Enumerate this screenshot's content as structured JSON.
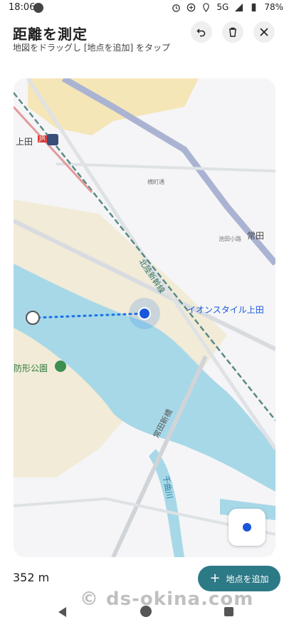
{
  "status_bar": {
    "time": "18:06",
    "network": "5G",
    "battery": "78%"
  },
  "header": {
    "title": "距離を測定",
    "subtitle": "地図をドラッグし [地点を追加] をタップ",
    "undo_icon": "undo-icon",
    "delete_icon": "trash-icon",
    "close_icon": "close-icon"
  },
  "map": {
    "labels": {
      "station": "上田",
      "station_badge": "JR",
      "railway": "北陸新幹線",
      "store": "イオンスタイル上田",
      "district": "常田",
      "park": "防形公園",
      "bridge": "常田新橋",
      "river": "千曲川",
      "street1": "横町通",
      "street2": "池田小路"
    },
    "colors": {
      "water": "#a7d8e8",
      "parkland": "#f1ebd8",
      "urban": "#f5e6b8",
      "highway": "#aab4d2",
      "measure_line": "#1a73e8"
    }
  },
  "distance": "352 m",
  "add_point_button": "地点を追加",
  "watermark": "© ds-okina.com"
}
